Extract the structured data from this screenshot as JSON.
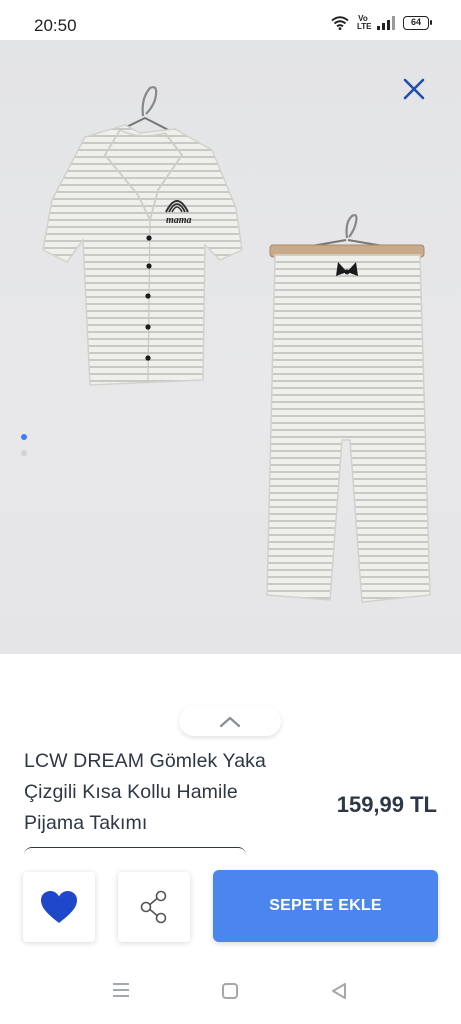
{
  "status_bar": {
    "time": "20:50",
    "network_label_top": "Vo",
    "network_label_bottom": "LTE",
    "battery": "64"
  },
  "gallery": {
    "image_description_icons": [
      "pajama-top-icon",
      "pajama-pants-icon"
    ],
    "top_print_text": "mama",
    "dots_count": 2,
    "active_dot": 0
  },
  "product": {
    "title": "LCW DREAM Gömlek Yaka Çizgili Kısa Kollu Hamile Pijama Takımı",
    "price": "159,99 TL"
  },
  "actions": {
    "add_to_cart_label": "SEPETE EKLE"
  },
  "colors": {
    "accent": "#4a86ee",
    "heart": "#1f47c9",
    "text": "#2e3745",
    "dot_active": "#3b7ff2"
  }
}
